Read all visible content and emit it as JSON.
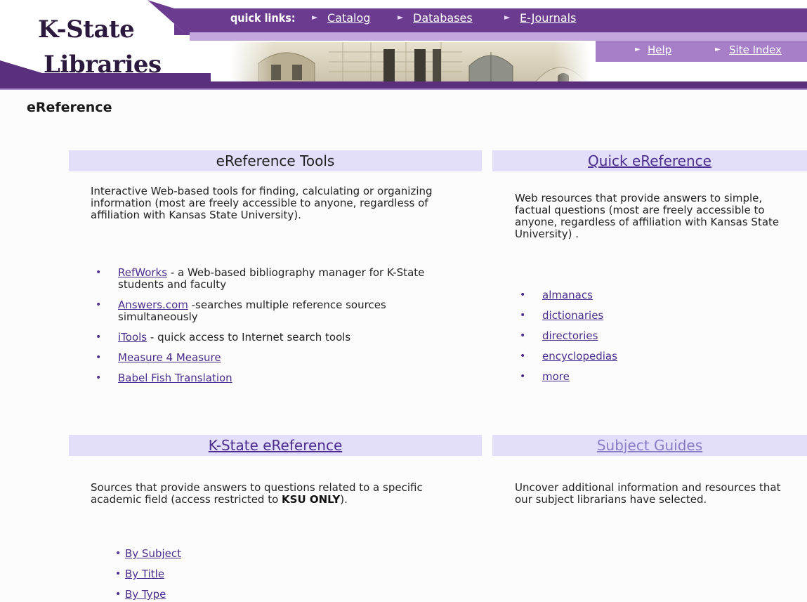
{
  "header": {
    "logo_line1": "K-State",
    "logo_line2": "Libraries",
    "quick_links_label": "quick links:",
    "quick_links": [
      {
        "label": "Catalog"
      },
      {
        "label": "Databases"
      },
      {
        "label": "E-Journals"
      }
    ],
    "right_links": [
      {
        "label": "Help"
      },
      {
        "label": "Site Index"
      }
    ],
    "colors": {
      "purple_dark": "#5a2f7e",
      "purple_mid": "#6b3b8f",
      "purple_light": "#c4a7dc",
      "section_bg": "#e3defa"
    }
  },
  "page_title": "eReference",
  "sections": {
    "tools": {
      "heading": "eReference Tools",
      "description": "Interactive Web-based tools for finding, calculating or organizing information (most are freely accessible to anyone, regardless of affiliation with Kansas State University).",
      "items": [
        {
          "link": "RefWorks",
          "rest": " - a Web-based bibliography manager for K-State students and faculty"
        },
        {
          "link": "Answers.com",
          "rest": " -searches multiple reference sources simultaneously"
        },
        {
          "link": "iTools",
          "rest": " - quick access to Internet search tools"
        },
        {
          "link": "Measure 4 Measure",
          "rest": ""
        },
        {
          "link": "Babel Fish Translation",
          "rest": ""
        }
      ]
    },
    "quick": {
      "heading": "Quick eReference",
      "description": "Web resources that provide answers to simple, factual questions (most are freely accessible to anyone, regardless of affiliation with Kansas State University) .",
      "items": [
        {
          "link": "almanacs"
        },
        {
          "link": "dictionaries"
        },
        {
          "link": "directories"
        },
        {
          "link": "encyclopedias"
        },
        {
          "link": "more"
        }
      ]
    },
    "kstate": {
      "heading": "K-State eReference",
      "description_before": "Sources that provide answers to questions related to a specific academic field (access restricted to ",
      "description_bold": "KSU ONLY",
      "description_after": ").",
      "items": [
        {
          "link": "By Subject"
        },
        {
          "link": "By Title"
        },
        {
          "link": "By Type"
        }
      ]
    },
    "guides": {
      "heading": "Subject Guides",
      "description": "Uncover additional information and resources that our subject librarians have selected."
    }
  }
}
